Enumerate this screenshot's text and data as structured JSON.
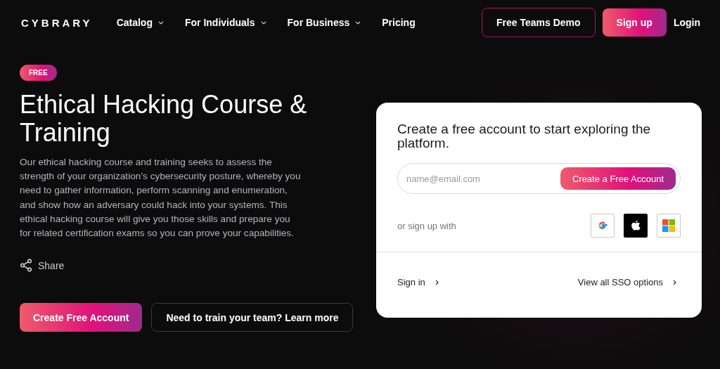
{
  "header": {
    "logo": "CYBRARY",
    "nav": [
      {
        "label": "Catalog",
        "dropdown": true
      },
      {
        "label": "For Individuals",
        "dropdown": true
      },
      {
        "label": "For Business",
        "dropdown": true
      },
      {
        "label": "Pricing",
        "dropdown": false
      }
    ],
    "demo_button": "Free Teams Demo",
    "signup_button": "Sign up",
    "login": "Login"
  },
  "hero": {
    "badge": "FREE",
    "title": "Ethical Hacking Course & Training",
    "description": "Our ethical hacking course and training seeks to assess the strength of your organization’s cybersecurity posture, whereby you need to gather information, perform scanning and enumeration, and show how an adversary could hack into your systems. This ethical hacking course will give you those skills and prepare you for related certification exams so you can prove your capabilities.",
    "share": "Share",
    "primary_button": "Create Free Account",
    "secondary_button": "Need to train your team? Learn more"
  },
  "signup_card": {
    "heading": "Create a free account to start exploring the platform.",
    "email": {
      "placeholder": "name@email.com"
    },
    "submit": "Create a Free Account",
    "sso_label": "or sign up with",
    "sso": [
      {
        "kind": "google"
      },
      {
        "kind": "apple"
      },
      {
        "kind": "microsoft"
      }
    ],
    "sign_in": "Sign in",
    "all_sso": "View all SSO options"
  }
}
